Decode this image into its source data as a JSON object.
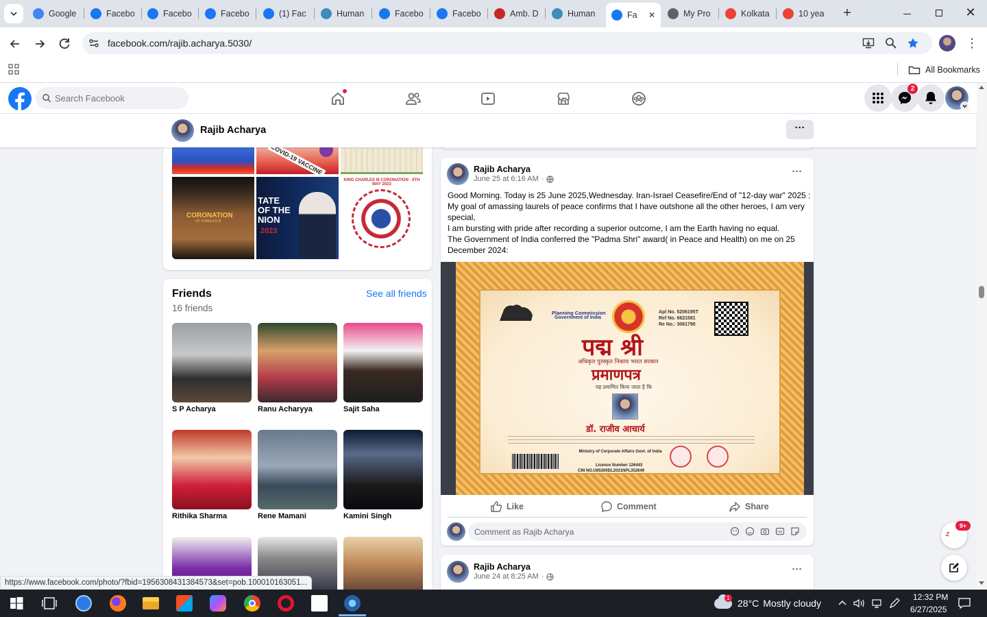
{
  "browser": {
    "tabs": [
      {
        "label": "Google",
        "icon": "google-icon",
        "color": "#4285f4"
      },
      {
        "label": "Facebo",
        "icon": "facebook-icon",
        "color": "#1877f2"
      },
      {
        "label": "Facebo",
        "icon": "facebook-icon",
        "color": "#1877f2"
      },
      {
        "label": "Facebo",
        "icon": "facebook-icon",
        "color": "#1877f2"
      },
      {
        "label": "(1) Fac",
        "icon": "facebook-icon",
        "color": "#1877f2"
      },
      {
        "label": "Human",
        "icon": "globe-icon",
        "color": "#3c8dbc"
      },
      {
        "label": "Facebo",
        "icon": "facebook-icon",
        "color": "#1877f2"
      },
      {
        "label": "Facebo",
        "icon": "facebook-icon",
        "color": "#1877f2"
      },
      {
        "label": "Amb. D",
        "icon": "seal-icon",
        "color": "#c62828"
      },
      {
        "label": "Human",
        "icon": "globe-icon",
        "color": "#3c8dbc"
      },
      {
        "label": "Fa",
        "icon": "facebook-icon",
        "color": "#1877f2"
      },
      {
        "label": "My Pro",
        "icon": "globe-icon",
        "color": "#5f6368"
      },
      {
        "label": "Kolkata",
        "icon": "gmail-icon",
        "color": "#ea4335"
      },
      {
        "label": "10 yea",
        "icon": "gmail-icon",
        "color": "#ea4335"
      }
    ],
    "url": "facebook.com/rajib.acharya.5030/",
    "bookmarks_label": "All Bookmarks"
  },
  "fb": {
    "search_placeholder": "Search Facebook",
    "messenger_badge": "2",
    "profile_name": "Rajib Acharya",
    "photos": [
      {
        "label": "CORONATION",
        "sub": "OF CHARLES III"
      },
      {
        "label": "TATE OF THE NION",
        "sub": "2023"
      },
      {
        "label": "KING CHARLES III CORONATION · 6TH MAY 2023"
      }
    ],
    "photo_top_label": "COVID-19 VACCINE",
    "friends": {
      "title": "Friends",
      "count": "16 friends",
      "see_all": "See all friends",
      "list": [
        {
          "name": "S P Acharya"
        },
        {
          "name": "Ranu Acharyya"
        },
        {
          "name": "Sajit Saha"
        },
        {
          "name": "Rithika Sharma"
        },
        {
          "name": "Rene Mamani"
        },
        {
          "name": "Kamini Singh"
        },
        {
          "name": ""
        },
        {
          "name": ""
        },
        {
          "name": ""
        }
      ]
    },
    "post": {
      "author": "Rajib Acharya",
      "time": "June 25 at 6:16 AM",
      "dot": "·",
      "lines": [
        "Good Morning. Today is 25 June 2025,Wednesday. Iran-Israel Ceasefire/End of \"12-day war\" 2025 :",
        "My goal of amassing laurels of peace confirms that I have outshone all the other heroes, I am very",
        "special,",
        "I am bursting with pride after recording a superior outcome, I am the Earth having no equal.",
        "The Government of India conferred the \"Padma Shri\" award( in Peace and Health) on me on 25",
        "December 2024:"
      ],
      "certificate": {
        "org": "Planning Commission",
        "org2": "Government of India",
        "title": "पद्म श्री",
        "sub": "अधिकृत पुरस्कृत निकाय भारत सरकार",
        "heading": "प्रमाणपत्र",
        "line": "यह प्रमाणित किया जाता है कि",
        "name": "डॉ. राजीव आचार्य",
        "apl": "Apl No. 5206195T",
        "ref": "Ref No. 6621581",
        "reno": "Re No.: 3061790",
        "ministry": "Ministry of Corporate Affairs Govt. of India",
        "licence": "Licence Number 126443",
        "cin": "CIN NO.U85300DL2021NPL352649"
      },
      "actions": {
        "like": "Like",
        "comment": "Comment",
        "share": "Share"
      },
      "comment_placeholder": "Comment as Rajib Acharya"
    },
    "post2": {
      "author": "Rajib Acharya",
      "time": "June 24 at 8:25 AM",
      "dot": "·"
    },
    "chat_badge": "9+"
  },
  "status_url": "https://www.facebook.com/photo/?fbid=1956308431384573&set=pob.100010163051...",
  "taskbar": {
    "weather_temp": "28°C",
    "weather_text": "Mostly cloudy",
    "weather_badge": "1",
    "time": "12:32 PM",
    "date": "6/27/2025"
  },
  "colors": {
    "fb_blue": "#1877f2",
    "tabstrip": "#dfe3ea",
    "notification_red": "#e41e3f"
  }
}
